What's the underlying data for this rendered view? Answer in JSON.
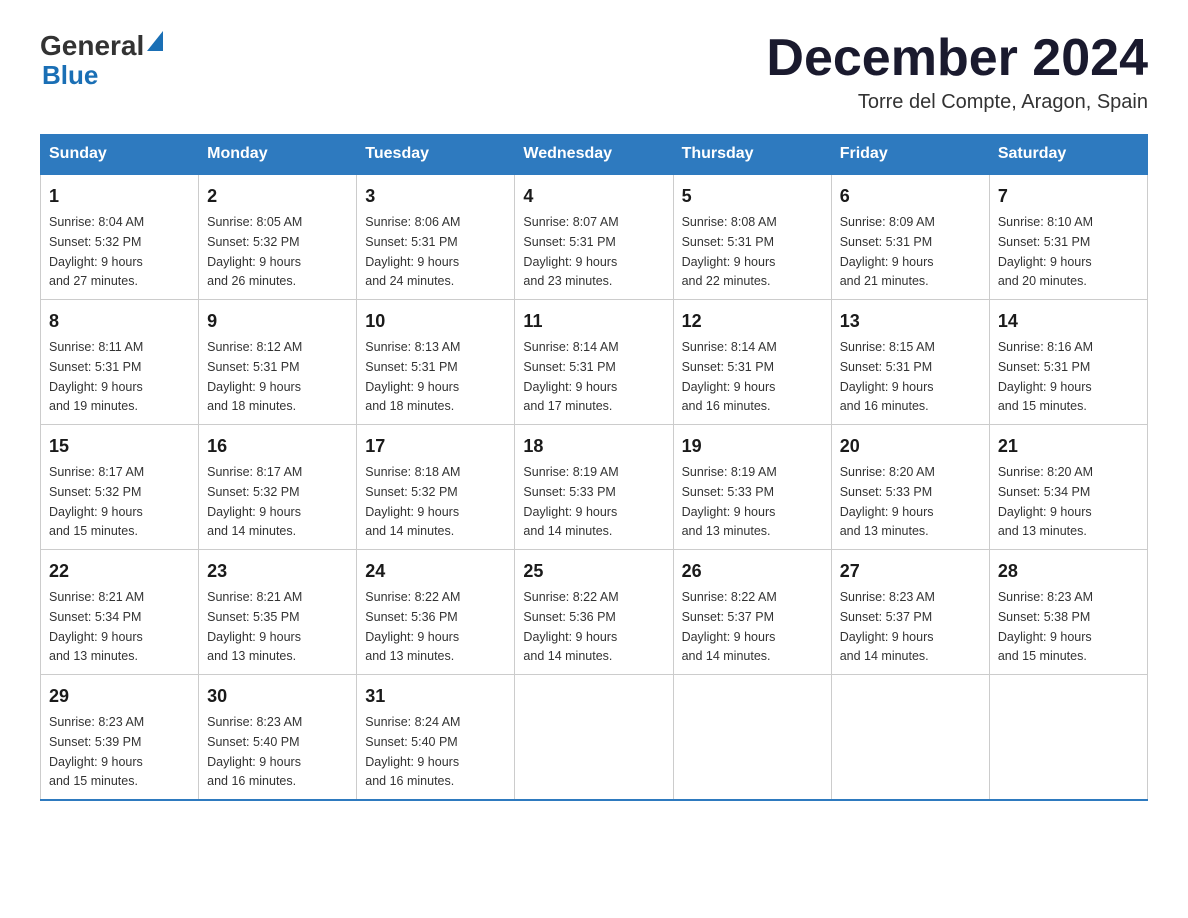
{
  "logo": {
    "general": "General",
    "triangle": "▶",
    "blue": "Blue"
  },
  "title": {
    "month": "December 2024",
    "location": "Torre del Compte, Aragon, Spain"
  },
  "days_of_week": [
    "Sunday",
    "Monday",
    "Tuesday",
    "Wednesday",
    "Thursday",
    "Friday",
    "Saturday"
  ],
  "weeks": [
    [
      {
        "day": "1",
        "info": "Sunrise: 8:04 AM\nSunset: 5:32 PM\nDaylight: 9 hours\nand 27 minutes."
      },
      {
        "day": "2",
        "info": "Sunrise: 8:05 AM\nSunset: 5:32 PM\nDaylight: 9 hours\nand 26 minutes."
      },
      {
        "day": "3",
        "info": "Sunrise: 8:06 AM\nSunset: 5:31 PM\nDaylight: 9 hours\nand 24 minutes."
      },
      {
        "day": "4",
        "info": "Sunrise: 8:07 AM\nSunset: 5:31 PM\nDaylight: 9 hours\nand 23 minutes."
      },
      {
        "day": "5",
        "info": "Sunrise: 8:08 AM\nSunset: 5:31 PM\nDaylight: 9 hours\nand 22 minutes."
      },
      {
        "day": "6",
        "info": "Sunrise: 8:09 AM\nSunset: 5:31 PM\nDaylight: 9 hours\nand 21 minutes."
      },
      {
        "day": "7",
        "info": "Sunrise: 8:10 AM\nSunset: 5:31 PM\nDaylight: 9 hours\nand 20 minutes."
      }
    ],
    [
      {
        "day": "8",
        "info": "Sunrise: 8:11 AM\nSunset: 5:31 PM\nDaylight: 9 hours\nand 19 minutes."
      },
      {
        "day": "9",
        "info": "Sunrise: 8:12 AM\nSunset: 5:31 PM\nDaylight: 9 hours\nand 18 minutes."
      },
      {
        "day": "10",
        "info": "Sunrise: 8:13 AM\nSunset: 5:31 PM\nDaylight: 9 hours\nand 18 minutes."
      },
      {
        "day": "11",
        "info": "Sunrise: 8:14 AM\nSunset: 5:31 PM\nDaylight: 9 hours\nand 17 minutes."
      },
      {
        "day": "12",
        "info": "Sunrise: 8:14 AM\nSunset: 5:31 PM\nDaylight: 9 hours\nand 16 minutes."
      },
      {
        "day": "13",
        "info": "Sunrise: 8:15 AM\nSunset: 5:31 PM\nDaylight: 9 hours\nand 16 minutes."
      },
      {
        "day": "14",
        "info": "Sunrise: 8:16 AM\nSunset: 5:31 PM\nDaylight: 9 hours\nand 15 minutes."
      }
    ],
    [
      {
        "day": "15",
        "info": "Sunrise: 8:17 AM\nSunset: 5:32 PM\nDaylight: 9 hours\nand 15 minutes."
      },
      {
        "day": "16",
        "info": "Sunrise: 8:17 AM\nSunset: 5:32 PM\nDaylight: 9 hours\nand 14 minutes."
      },
      {
        "day": "17",
        "info": "Sunrise: 8:18 AM\nSunset: 5:32 PM\nDaylight: 9 hours\nand 14 minutes."
      },
      {
        "day": "18",
        "info": "Sunrise: 8:19 AM\nSunset: 5:33 PM\nDaylight: 9 hours\nand 14 minutes."
      },
      {
        "day": "19",
        "info": "Sunrise: 8:19 AM\nSunset: 5:33 PM\nDaylight: 9 hours\nand 13 minutes."
      },
      {
        "day": "20",
        "info": "Sunrise: 8:20 AM\nSunset: 5:33 PM\nDaylight: 9 hours\nand 13 minutes."
      },
      {
        "day": "21",
        "info": "Sunrise: 8:20 AM\nSunset: 5:34 PM\nDaylight: 9 hours\nand 13 minutes."
      }
    ],
    [
      {
        "day": "22",
        "info": "Sunrise: 8:21 AM\nSunset: 5:34 PM\nDaylight: 9 hours\nand 13 minutes."
      },
      {
        "day": "23",
        "info": "Sunrise: 8:21 AM\nSunset: 5:35 PM\nDaylight: 9 hours\nand 13 minutes."
      },
      {
        "day": "24",
        "info": "Sunrise: 8:22 AM\nSunset: 5:36 PM\nDaylight: 9 hours\nand 13 minutes."
      },
      {
        "day": "25",
        "info": "Sunrise: 8:22 AM\nSunset: 5:36 PM\nDaylight: 9 hours\nand 14 minutes."
      },
      {
        "day": "26",
        "info": "Sunrise: 8:22 AM\nSunset: 5:37 PM\nDaylight: 9 hours\nand 14 minutes."
      },
      {
        "day": "27",
        "info": "Sunrise: 8:23 AM\nSunset: 5:37 PM\nDaylight: 9 hours\nand 14 minutes."
      },
      {
        "day": "28",
        "info": "Sunrise: 8:23 AM\nSunset: 5:38 PM\nDaylight: 9 hours\nand 15 minutes."
      }
    ],
    [
      {
        "day": "29",
        "info": "Sunrise: 8:23 AM\nSunset: 5:39 PM\nDaylight: 9 hours\nand 15 minutes."
      },
      {
        "day": "30",
        "info": "Sunrise: 8:23 AM\nSunset: 5:40 PM\nDaylight: 9 hours\nand 16 minutes."
      },
      {
        "day": "31",
        "info": "Sunrise: 8:24 AM\nSunset: 5:40 PM\nDaylight: 9 hours\nand 16 minutes."
      },
      {
        "day": "",
        "info": ""
      },
      {
        "day": "",
        "info": ""
      },
      {
        "day": "",
        "info": ""
      },
      {
        "day": "",
        "info": ""
      }
    ]
  ]
}
